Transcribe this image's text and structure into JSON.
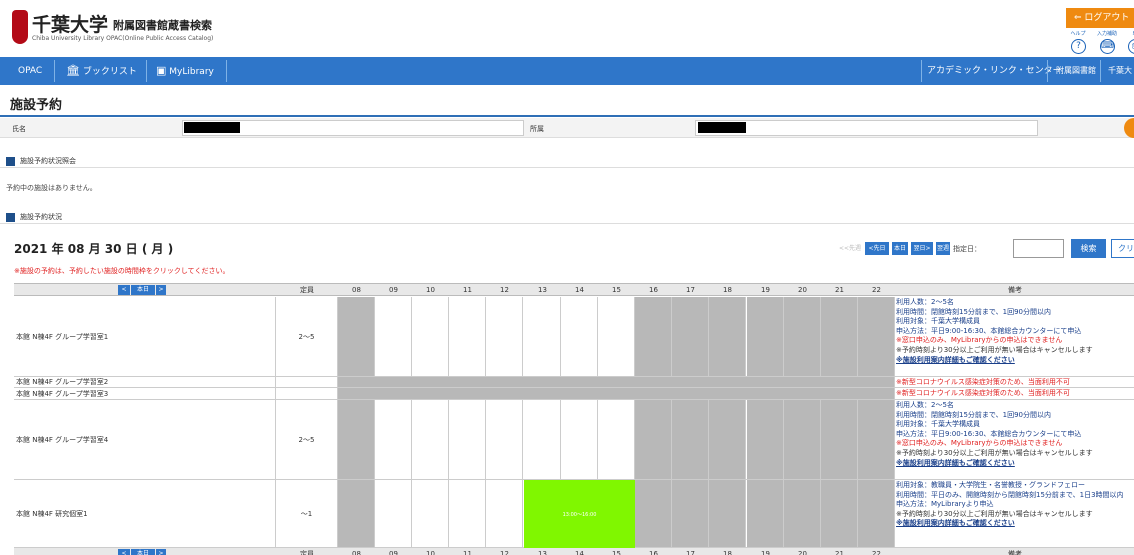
{
  "header": {
    "logo_main": "千葉大学",
    "logo_sub": "附属図書館蔵書検索",
    "logo_en": "Chiba University Library OPAC(Online Public Access Catalog)",
    "logout_label": "ログアウト",
    "menus": [
      "ヘルプ",
      "入力補助",
      "印"
    ]
  },
  "nav": {
    "opac": "OPAC",
    "booklist": "ブックリスト",
    "mylibrary": "MyLibrary",
    "academic_link": "アカデミック・リンク・センター",
    "library": "附属図書館",
    "chiba": "千葉大"
  },
  "page": {
    "title": "施設予約",
    "name_label": "氏名",
    "affiliation_label": "所属",
    "section_inquiry": "施設予約状況照会",
    "no_reservations": "予約中の施設はありません。",
    "section_status": "施設予約状況",
    "date": "2021 年 08 月 30 日 ( 月 )",
    "note": "※施設の予約は、予約したい施設の時間枠をクリックしてください。"
  },
  "date_nav": {
    "prev_week": "<<先週",
    "prev_day": "<先日",
    "today": "本日",
    "next_day": "翌日>",
    "next_week": "翌週>>",
    "date_label": "指定日：",
    "search": "検索",
    "clear": "クリア"
  },
  "table": {
    "nav_prev": "<",
    "nav_today": "本日",
    "nav_next": ">",
    "capacity_header": "定員",
    "hours": [
      "08",
      "09",
      "10",
      "11",
      "12",
      "13",
      "14",
      "15",
      "16",
      "17",
      "18",
      "19",
      "20",
      "21",
      "22"
    ],
    "remarks_header": "備考",
    "rows": [
      {
        "name": "本館 N棟4F グループ学習室1",
        "capacity": "2～5",
        "remarks": [
          {
            "cls": "b",
            "text": "利用人数：2～5名"
          },
          {
            "cls": "b",
            "text": "利用時間：閉館時刻15分前まで、1回90分間以内"
          },
          {
            "cls": "b",
            "text": "利用対象：千葉大学構成員"
          },
          {
            "cls": "b",
            "text": "申込方法：平日9:00-16:30、本館総合カウンターにて申込"
          },
          {
            "cls": "r",
            "text": "※窓口申込のみ、MyLibraryからの申込はできません"
          },
          {
            "cls": "",
            "text": "※予約時刻より30分以上ご利用が無い場合はキャンセルします"
          },
          {
            "cls": "bb",
            "text": "※施設利用案内詳細もご確認ください"
          }
        ]
      },
      {
        "name": "本館 N棟4F グループ学習室2",
        "capacity": "",
        "remarks": [
          {
            "cls": "r",
            "text": "※新型コロナウイルス感染症対策のため、当面利用不可"
          }
        ]
      },
      {
        "name": "本館 N棟4F グループ学習室3",
        "capacity": "",
        "remarks": [
          {
            "cls": "r",
            "text": "※新型コロナウイルス感染症対策のため、当面利用不可"
          }
        ]
      },
      {
        "name": "本館 N棟4F グループ学習室4",
        "capacity": "2～5",
        "remarks": [
          {
            "cls": "b",
            "text": "利用人数：2～5名"
          },
          {
            "cls": "b",
            "text": "利用時間：閉館時刻15分前まで、1回90分間以内"
          },
          {
            "cls": "b",
            "text": "利用対象：千葉大学構成員"
          },
          {
            "cls": "b",
            "text": "申込方法：平日9:00-16:30、本館総合カウンターにて申込"
          },
          {
            "cls": "r",
            "text": "※窓口申込のみ、MyLibraryからの申込はできません"
          },
          {
            "cls": "",
            "text": "※予約時刻より30分以上ご利用が無い場合はキャンセルします"
          },
          {
            "cls": "bb",
            "text": "※施設利用案内詳細もご確認ください"
          }
        ]
      },
      {
        "name": "本館 N棟4F 研究個室1",
        "capacity": "～1",
        "booking": "13:00～16:00",
        "remarks": [
          {
            "cls": "b",
            "text": "利用対象：教職員・大学院生・名誉教授・グランドフェロー"
          },
          {
            "cls": "b",
            "text": "利用時間：平日のみ、開館時刻から閉館時刻15分前まで、1日3時間以内"
          },
          {
            "cls": "b",
            "text": "申込方法：MyLibraryより申込"
          },
          {
            "cls": "",
            "text": "※予約時刻より30分以上ご利用が無い場合はキャンセルします"
          },
          {
            "cls": "bb",
            "text": "※施設利用案内詳細もご確認ください"
          }
        ]
      }
    ]
  }
}
